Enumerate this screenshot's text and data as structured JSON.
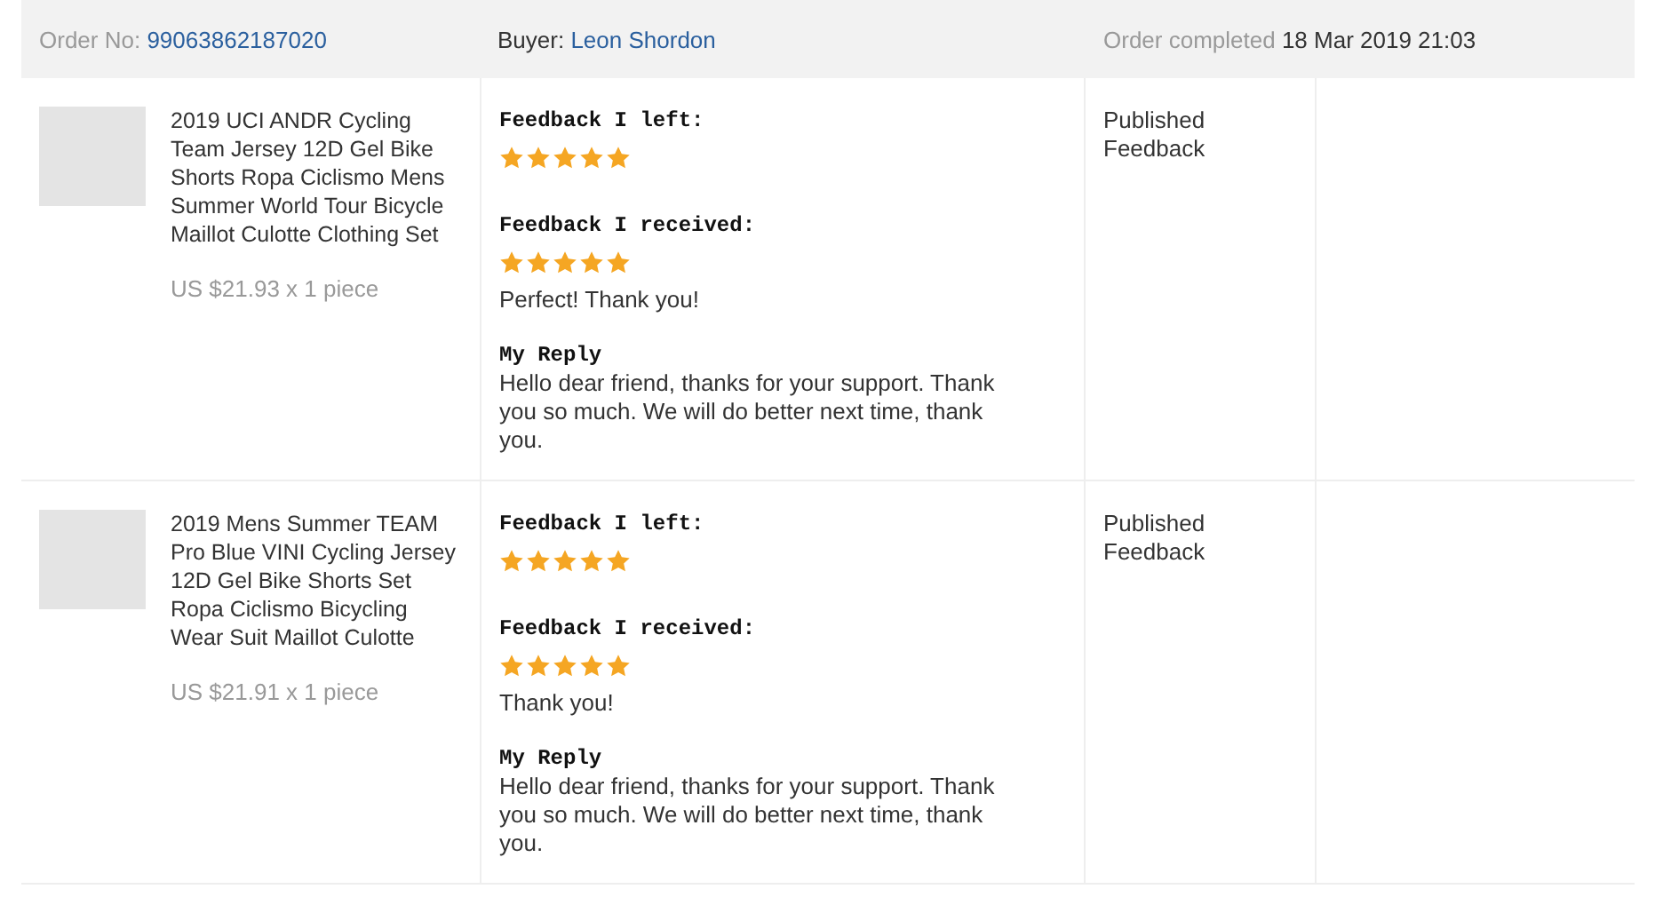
{
  "order": {
    "number_label": "Order No:",
    "number": "99063862187020",
    "buyer_label": "Buyer:",
    "buyer": "Leon Shordon",
    "status_label": "Order completed",
    "date": "18 Mar 2019 21:03"
  },
  "items": [
    {
      "title": "2019 UCI ANDR Cycling Team Jersey 12D Gel Bike Shorts Ropa Ciclismo Mens Summer World Tour Bicycle Maillot Culotte Clothing Set",
      "price": "US $21.93 x 1 piece",
      "left": {
        "label": "Feedback I left:",
        "stars": 5
      },
      "received": {
        "label": "Feedback I received:",
        "stars": 5
      },
      "comment": "Perfect! Thank you!",
      "reply_label": "My Reply",
      "reply": "Hello dear friend, thanks for your support. Thank you so much. We will do better next time, thank you.",
      "status": "Published Feedback"
    },
    {
      "title": "2019 Mens Summer TEAM Pro Blue VINI Cycling Jersey 12D Gel Bike Shorts Set Ropa Ciclismo Bicycling Wear Suit Maillot Culotte",
      "price": "US $21.91 x 1 piece",
      "left": {
        "label": "Feedback I left:",
        "stars": 5
      },
      "received": {
        "label": "Feedback I received:",
        "stars": 5
      },
      "comment": "Thank you!",
      "reply_label": "My Reply",
      "reply": "Hello dear friend, thanks for your support. Thank you so much. We will do better next time, thank you.",
      "status": "Published Feedback"
    }
  ]
}
